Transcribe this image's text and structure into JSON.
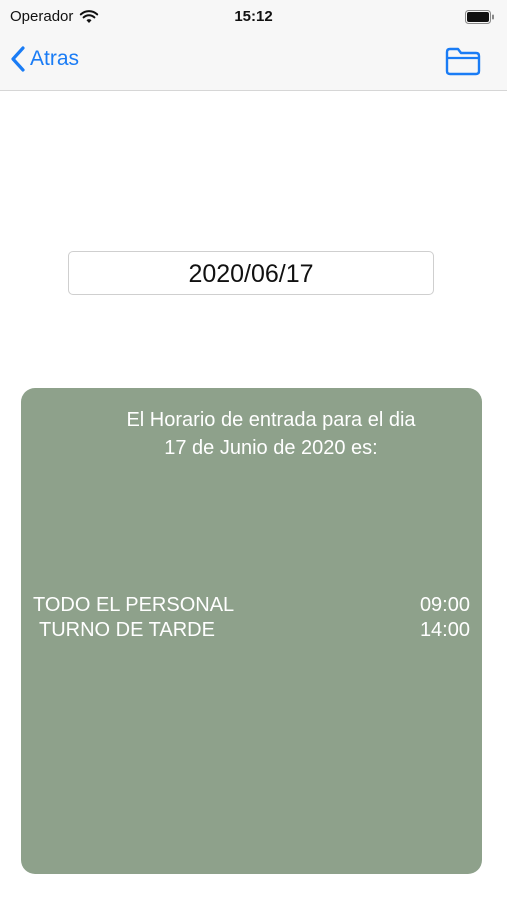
{
  "status_bar": {
    "carrier": "Operador",
    "time": "15:12"
  },
  "nav": {
    "back_label": "Atras"
  },
  "date_field": {
    "value": "2020/06/17"
  },
  "card": {
    "heading": "El Horario de entrada para el dia 17 de Junio de 2020 es:",
    "rows": [
      {
        "name": "TODO EL PERSONAL",
        "time": "09:00"
      },
      {
        "name": "TURNO DE TARDE",
        "time": "14:00"
      }
    ]
  },
  "colors": {
    "accent": "#1a7cf5",
    "card_bg": "#8ea18b"
  },
  "icons": [
    "wifi-icon",
    "battery-icon",
    "chevron-left-icon",
    "folder-icon"
  ]
}
